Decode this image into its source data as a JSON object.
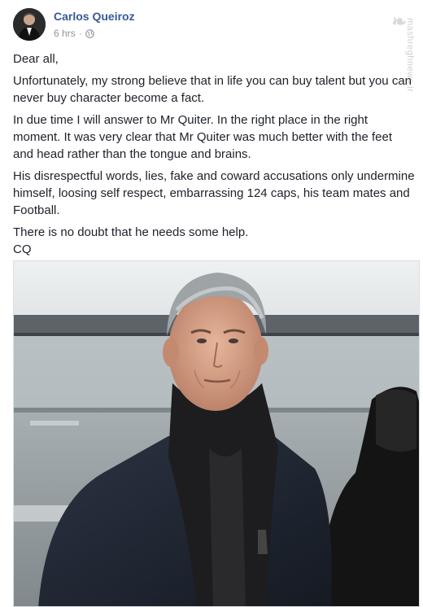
{
  "post": {
    "author": "Carlos Queiroz",
    "time": "6 hrs",
    "separator": "·",
    "audience_icon": "globe-icon",
    "watermark_text": "mashreghnews.ir",
    "paragraphs": [
      "Dear all,",
      "Unfortunately, my strong believe that in life you can buy talent but you can never buy character become a fact.",
      "In due time I will answer to Mr Quiter. In the right place in the right moment. It was very clear that Mr Quiter was much better with the feet and head rather than the tongue and brains.",
      "His disrespectful words, lies, fake and coward accusations only undermine himself, loosing self respect, embarrassing 124 caps, his team mates and Football.",
      "There is no doubt that he needs some help."
    ],
    "signature": "CQ"
  },
  "colors": {
    "author_link": "#365899",
    "meta_gray": "#90949c",
    "text": "#1d2129"
  }
}
